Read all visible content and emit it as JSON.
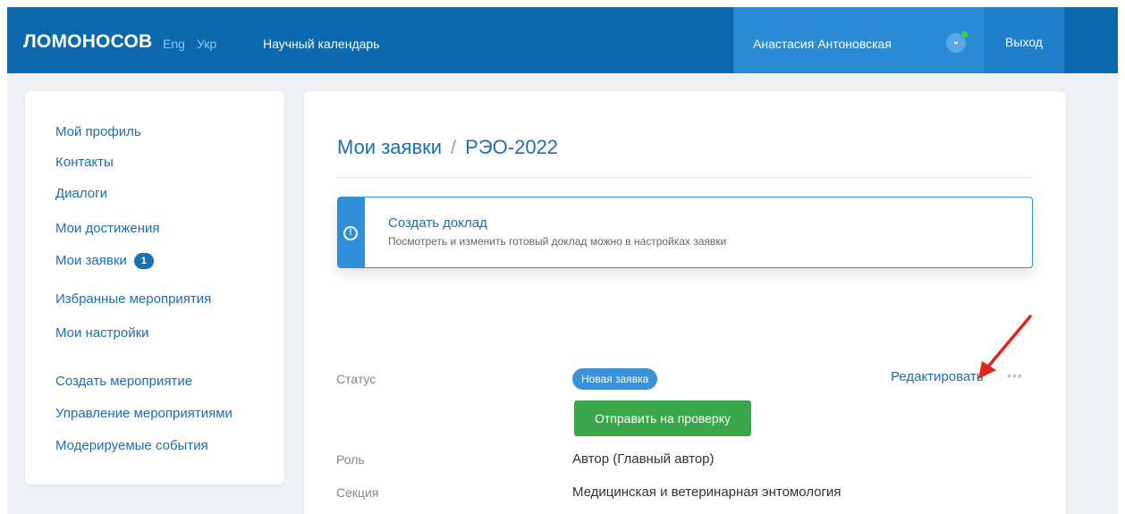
{
  "header": {
    "brand": "ЛОМОНОСОВ",
    "lang_eng": "Eng",
    "lang_ukr": "Укр",
    "nav_link": "Научный календарь",
    "user_name": "Анастасия Антоновская",
    "user_menu_icon": "chevron-down",
    "logout": "Выход"
  },
  "sidebar": {
    "items": [
      {
        "label": "Мой профиль"
      },
      {
        "label": "Контакты"
      },
      {
        "label": "Диалоги"
      },
      {
        "label": "Мои достижения"
      },
      {
        "label": "Мои заявки",
        "badge": "1"
      },
      {
        "label": "Избранные мероприятия"
      },
      {
        "label": "Мои настройки"
      },
      {
        "label": "Создать мероприятие"
      },
      {
        "label": "Управление мероприятиями"
      },
      {
        "label": "Модерируемые события"
      }
    ]
  },
  "main": {
    "breadcrumb_parent": "Мои заявки",
    "breadcrumb_separator": "/",
    "breadcrumb_current": "РЭО-2022",
    "alert": {
      "icon": "exclamation-circle",
      "title": "Создать доклад",
      "text": "Посмотреть и изменить готовый доклад можно в настройках заявки"
    },
    "status_label": "Статус",
    "status_value": "Новая заявка",
    "edit_label": "Редактировать",
    "more_label": "•••",
    "submit_label": "Отправить на проверку",
    "role_label": "Роль",
    "role_value": "Автор (Главный автор)",
    "section_label": "Секция",
    "section_value": "Медицинская и ветеринарная энтомология"
  },
  "colors": {
    "navbar": "#0b68ad",
    "user_area": "#2a8ad4",
    "link": "#1d6fb5",
    "alert_accent": "#2f8fd8",
    "submit_button": "#3aa84a",
    "annotation_arrow": "#e0251b"
  }
}
